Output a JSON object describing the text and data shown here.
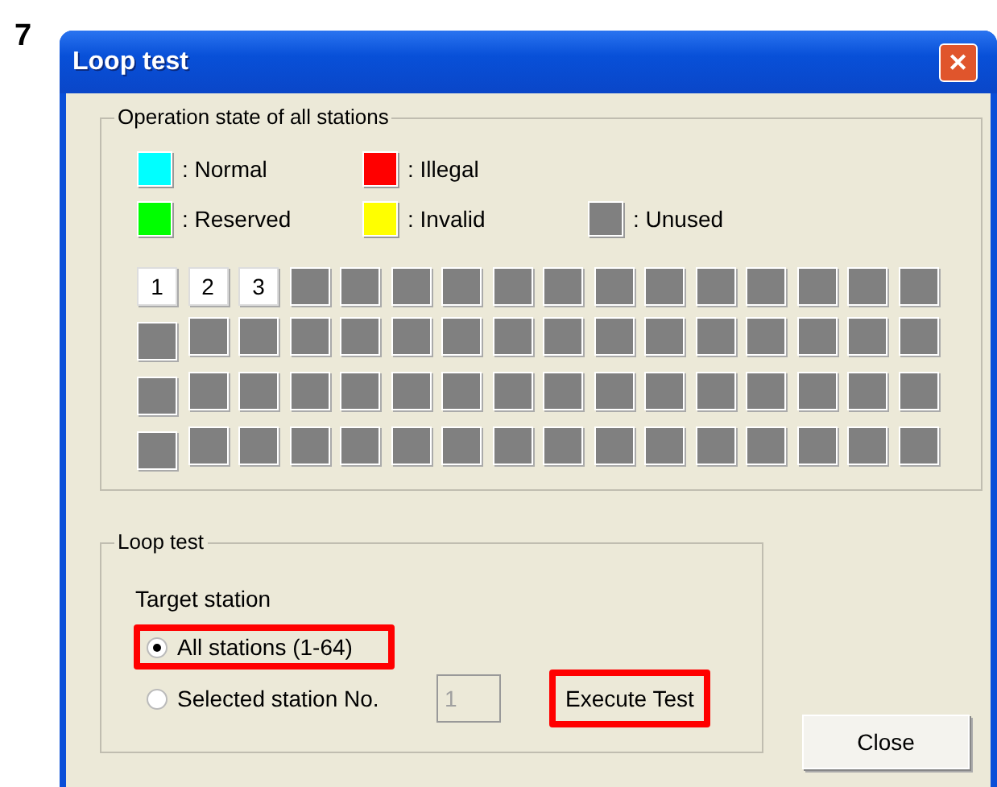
{
  "step_number": "7",
  "window": {
    "title": "Loop test",
    "close_glyph": "✕"
  },
  "state_group": {
    "title": "Operation state of all stations",
    "legend": [
      {
        "label": ": Normal",
        "color": "#00ffff"
      },
      {
        "label": ": Illegal",
        "color": "#ff0000"
      },
      {
        "label": ": Reserved",
        "color": "#00ff00"
      },
      {
        "label": ": Invalid",
        "color": "#ffff00"
      },
      {
        "label": ": Unused",
        "color": "#808080"
      }
    ],
    "stations": [
      {
        "kind": "numbered",
        "label": "1"
      },
      {
        "kind": "numbered",
        "label": "2"
      },
      {
        "kind": "numbered",
        "label": "3"
      },
      {
        "kind": "unused"
      },
      {
        "kind": "unused"
      },
      {
        "kind": "unused"
      },
      {
        "kind": "unused"
      },
      {
        "kind": "unused"
      },
      {
        "kind": "unused"
      },
      {
        "kind": "unused"
      },
      {
        "kind": "unused"
      },
      {
        "kind": "unused"
      },
      {
        "kind": "unused"
      },
      {
        "kind": "unused"
      },
      {
        "kind": "unused"
      },
      {
        "kind": "unused"
      },
      {
        "kind": "unused"
      },
      {
        "kind": "unused"
      },
      {
        "kind": "unused"
      },
      {
        "kind": "unused"
      },
      {
        "kind": "unused"
      },
      {
        "kind": "unused"
      },
      {
        "kind": "unused"
      },
      {
        "kind": "unused"
      },
      {
        "kind": "unused"
      },
      {
        "kind": "unused"
      },
      {
        "kind": "unused"
      },
      {
        "kind": "unused"
      },
      {
        "kind": "unused"
      },
      {
        "kind": "unused"
      },
      {
        "kind": "unused"
      },
      {
        "kind": "unused"
      },
      {
        "kind": "unused"
      },
      {
        "kind": "unused"
      },
      {
        "kind": "unused"
      },
      {
        "kind": "unused"
      },
      {
        "kind": "unused"
      },
      {
        "kind": "unused"
      },
      {
        "kind": "unused"
      },
      {
        "kind": "unused"
      },
      {
        "kind": "unused"
      },
      {
        "kind": "unused"
      },
      {
        "kind": "unused"
      },
      {
        "kind": "unused"
      },
      {
        "kind": "unused"
      },
      {
        "kind": "unused"
      },
      {
        "kind": "unused"
      },
      {
        "kind": "unused"
      },
      {
        "kind": "unused"
      },
      {
        "kind": "unused"
      },
      {
        "kind": "unused"
      },
      {
        "kind": "unused"
      },
      {
        "kind": "unused"
      },
      {
        "kind": "unused"
      },
      {
        "kind": "unused"
      },
      {
        "kind": "unused"
      },
      {
        "kind": "unused"
      },
      {
        "kind": "unused"
      },
      {
        "kind": "unused"
      },
      {
        "kind": "unused"
      },
      {
        "kind": "unused"
      },
      {
        "kind": "unused"
      },
      {
        "kind": "unused"
      },
      {
        "kind": "unused"
      }
    ]
  },
  "loop_group": {
    "title": "Loop test",
    "target_label": "Target station",
    "options": [
      {
        "label": "All stations (1-64)",
        "selected": true,
        "highlighted": true
      },
      {
        "label": "Selected station No.",
        "selected": false,
        "highlighted": false
      }
    ],
    "station_field": {
      "value": "1",
      "disabled": true
    },
    "execute_button": {
      "label": "Execute Test",
      "highlighted": true
    }
  },
  "close_button": {
    "label": "Close"
  }
}
